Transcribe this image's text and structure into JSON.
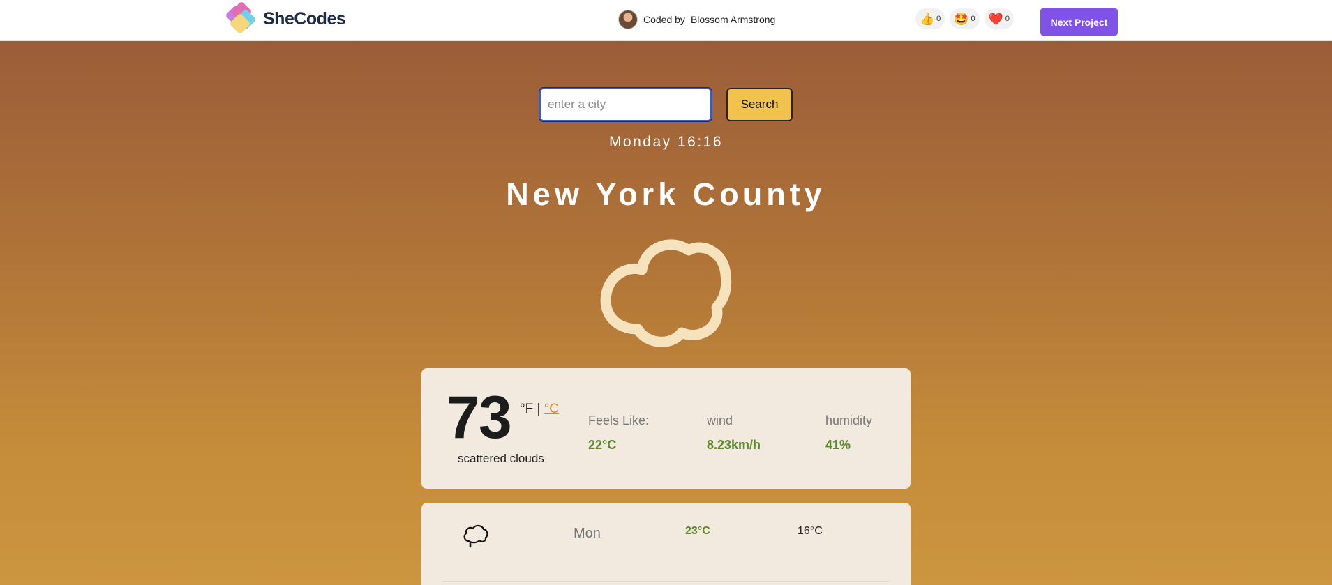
{
  "header": {
    "logo_text": "SheCodes",
    "coded_by_prefix": "Coded by",
    "author": "Blossom Armstrong",
    "reactions": [
      {
        "icon": "thumbs-up-icon",
        "emoji": "👍",
        "count": "0"
      },
      {
        "icon": "star-struck-icon",
        "emoji": "🤩",
        "count": "0"
      },
      {
        "icon": "heart-icon",
        "emoji": "❤️",
        "count": "0"
      }
    ],
    "next_project_label": "Next Project"
  },
  "search": {
    "placeholder": "enter a city",
    "value": "",
    "button_label": "Search"
  },
  "current": {
    "datetime": "Monday 16:16",
    "city": "New York County",
    "icon": "cloud-icon",
    "temperature": "73",
    "unit_f": "°F |",
    "unit_c": "°C",
    "description": "scattered clouds",
    "stats": [
      {
        "label": "Feels Like:",
        "value": "22°C"
      },
      {
        "label": "wind",
        "value": "8.23km/h"
      },
      {
        "label": "humidity",
        "value": "41%"
      }
    ]
  },
  "forecast": [
    {
      "icon": "cloud-rain-icon",
      "day": "Mon",
      "high": "23°C",
      "low": "16°C"
    }
  ],
  "colors": {
    "accent_purple": "#8152e8",
    "search_button": "#f2c24f",
    "stat_green": "#5c8a2a",
    "celsius_link": "#d88a2c",
    "card_bg": "#f3eadf",
    "gradient_top": "#9b5d38",
    "gradient_bottom": "#cc9540"
  }
}
